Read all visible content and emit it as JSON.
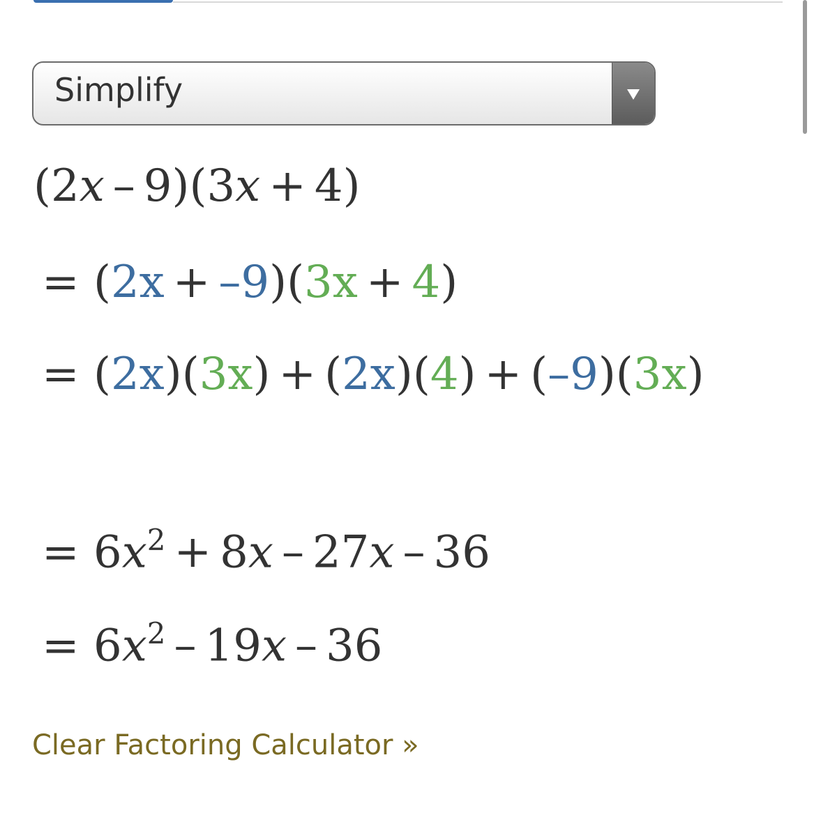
{
  "select": {
    "value": "Simplify"
  },
  "math": {
    "line0": {
      "open1": "(",
      "a": "2",
      "x1": "x",
      "minus": "–",
      "b": "9",
      "close1": ")(",
      "c": "3",
      "x2": "x",
      "plus": "+",
      "d": "4",
      "close2": ")"
    },
    "line1": {
      "eq": "=",
      "open": "(",
      "a": "2x",
      "plus1": "+",
      "b": "–9",
      "mid": ")(",
      "c": "3x",
      "plus2": "+",
      "d": "4",
      "close": ")"
    },
    "line2": {
      "eq": "=",
      "t1_open": "(",
      "t1_a": "2x",
      "t1_mid": ")(",
      "t1_b": "3x",
      "t1_close": ")",
      "plus1": "+",
      "t2_open": "(",
      "t2_a": "2x",
      "t2_mid": ")(",
      "t2_b": "4",
      "t2_close": ")",
      "plus2": "+",
      "t3_open": "(",
      "t3_a": "–9",
      "t3_mid": ")(",
      "t3_b": "3x",
      "t3_close": ")"
    },
    "line3": {
      "eq": "=",
      "c1": "6",
      "x": "x",
      "exp": "2",
      "plus": "+",
      "c2": "8",
      "x2": "x",
      "minus1": "–",
      "c3": "27",
      "x3": "x",
      "minus2": "–",
      "c4": "36"
    },
    "line4": {
      "eq": "=",
      "c1": "6",
      "x": "x",
      "exp": "2",
      "minus1": "–",
      "c2": "19",
      "x2": "x",
      "minus2": "–",
      "c3": "36"
    }
  },
  "link": {
    "clear": "Clear Factoring Calculator »"
  },
  "colors": {
    "term_a": "#3d6da0",
    "term_b": "#63ad55",
    "link": "#7a6a23"
  }
}
